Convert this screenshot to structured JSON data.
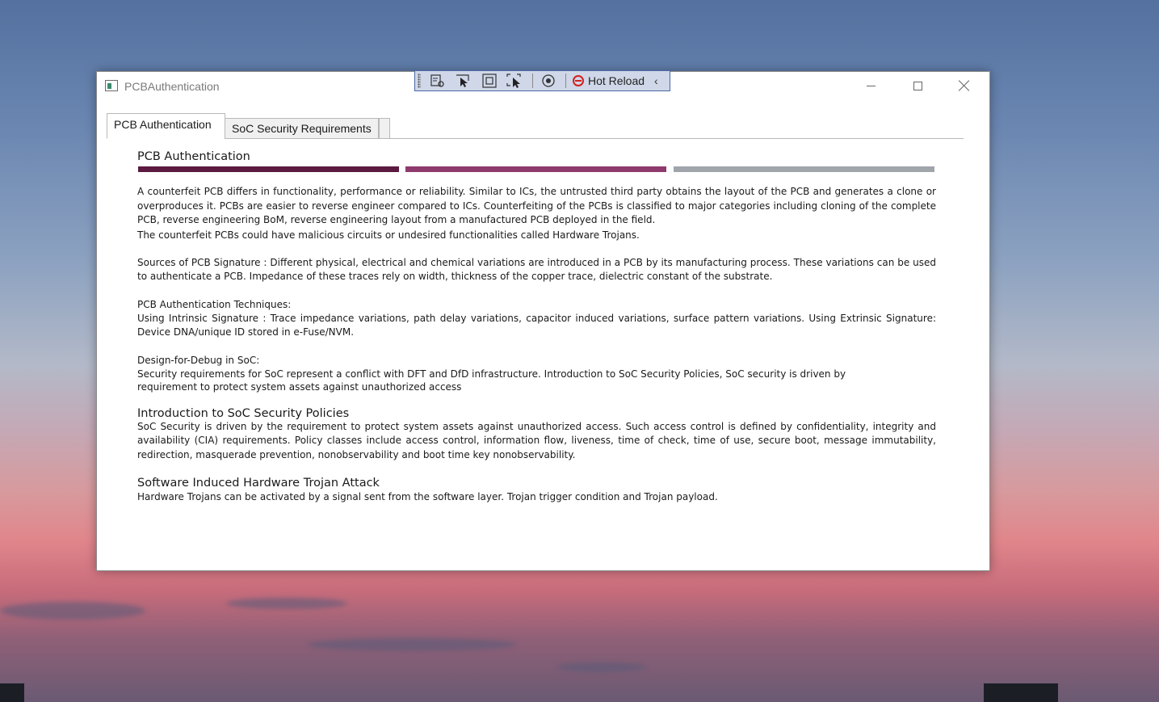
{
  "window": {
    "title": "PCBAuthentication",
    "controls": {
      "minimize": "—",
      "maximize": "☐",
      "close": "✕"
    }
  },
  "hot_reload_toolbar": {
    "label": "Hot Reload",
    "collapse": "‹",
    "tools": [
      "select-element-icon",
      "track-focus-icon",
      "display-layout-adorners-icon",
      "binding-failures-icon",
      "hot-reload-status-icon"
    ]
  },
  "tabs": [
    {
      "label": "PCB Authentication",
      "active": true
    },
    {
      "label": "SoC Security Requirements",
      "active": false
    }
  ],
  "section_bars": {
    "colors": [
      "#5c1a40",
      "#8e3a6c",
      "#a0a4ab"
    ]
  },
  "content": {
    "title": "PCB Authentication",
    "intro_1": "A counterfeit PCB differs in functionality, performance or reliability. Similar to ICs, the untrusted third party obtains the layout of the PCB and generates a clone or overproduces it.  PCBs are easier to reverse engineer compared to ICs.    Counterfeiting of the PCBs is classified to major categories including cloning of the complete PCB, reverse engineering BoM, reverse engineering layout from a manufactured PCB deployed in the field.",
    "intro_2": "The counterfeit PCBs could have malicious circuits or undesired functionalities called Hardware Trojans.",
    "sources": "Sources of PCB Signature :  Different physical, electrical and chemical variations are introduced in a PCB by its manufacturing process.  These variations can be used to authenticate a PCB. Impedance of these traces rely on width, thickness of the copper trace, dielectric constant of the substrate.",
    "techniques_heading": "PCB Authentication Techniques:",
    "techniques": "Using Intrinsic Signature : Trace impedance variations, path delay variations, capacitor induced variations, surface pattern variations. Using Extrinsic Signature: Device DNA/unique ID stored in e-Fuse/NVM.",
    "dfd_heading": "Design-for-Debug in SoC:",
    "dfd_1": "Security requirements for SoC represent a conflict with DFT and DfD infrastructure.  Introduction to SoC Security Policies, SoC security is driven by",
    "dfd_2": "requirement to protect system assets against unauthorized access",
    "policies_title": "Introduction to SoC Security Policies",
    "policies": "SoC Security is driven by the requirement to protect system assets against unauthorized access. Such access control is defined by confidentiality, integrity and availability (CIA) requirements.  Policy classes include access control, information flow, liveness, time of check, time of use, secure boot, message immutability, redirection, masquerade prevention, nonobservability and boot time key nonobservability.",
    "trojan_title": "Software Induced Hardware Trojan Attack",
    "trojan": "Hardware Trojans can be activated by a signal sent from the software layer. Trojan trigger condition and Trojan payload."
  }
}
